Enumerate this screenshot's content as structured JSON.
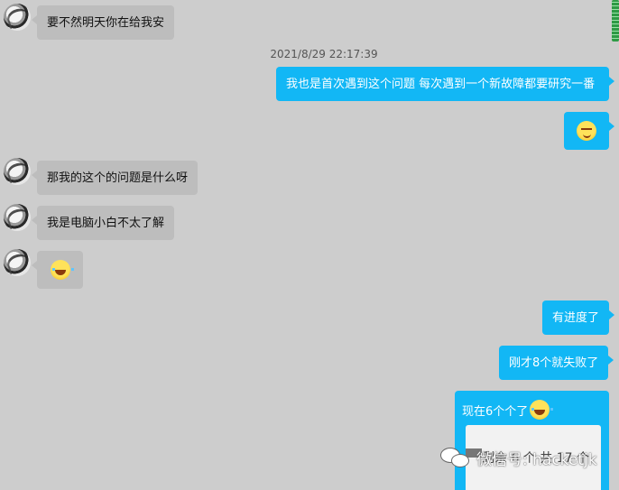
{
  "timestamp": "2021/8/29 22:17:39",
  "messages": {
    "m1": "要不然明天你在给我安",
    "m2": "我也是首次遇到这个问题  每次遇到一个新故障都要研究一番",
    "m4": "那我的这个的问题是什么呀",
    "m5": "我是电脑小白不太了解",
    "m7": "有进度了",
    "m8": "刚才8个就失败了",
    "m9": "现在6个个了",
    "m9_image_text": "剩余 6 个  共 17 个"
  },
  "emojis": {
    "smirk": "smirk-emoji",
    "laugh": "laugh-emoji"
  },
  "watermark": {
    "text": "微信号: hacketjk"
  },
  "colors": {
    "background": "#cdcdcd",
    "incoming_bubble": "#bdbdbd",
    "outgoing_bubble": "#12b7f5"
  }
}
